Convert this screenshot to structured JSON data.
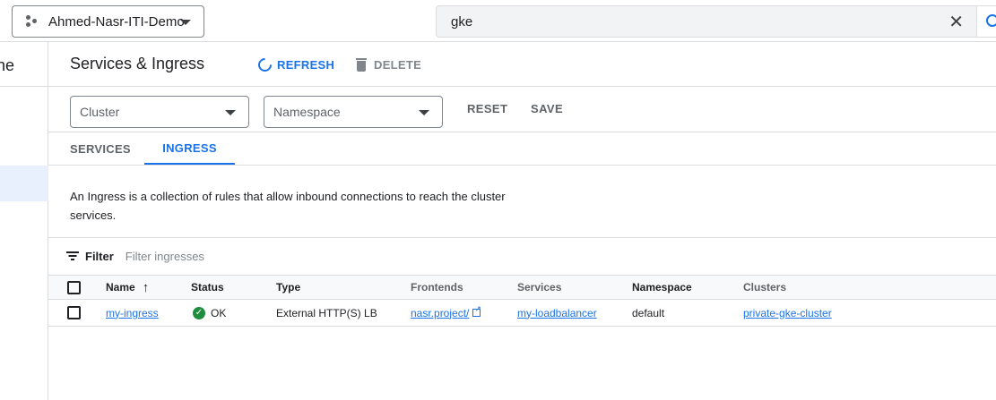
{
  "topbar": {
    "project_name": "Ahmed-Nasr-ITI-Demo",
    "search_value": "gke",
    "clear_glyph": "✕",
    "icons": [
      "project-dots-icon",
      "chevron-down-icon",
      "close-icon",
      "search-icon"
    ]
  },
  "leftnav": {
    "title_fragment": "ne"
  },
  "header": {
    "title": "Services & Ingress",
    "refresh_label": "REFRESH",
    "delete_label": "DELETE"
  },
  "filters": {
    "cluster_label": "Cluster",
    "namespace_label": "Namespace",
    "reset_label": "RESET",
    "save_label": "SAVE"
  },
  "tabs": [
    {
      "label": "SERVICES"
    },
    {
      "label": "INGRESS",
      "active": true
    }
  ],
  "description": "An Ingress is a collection of rules that allow inbound connections to reach the cluster services.",
  "table_filter": {
    "label": "Filter",
    "placeholder": "Filter ingresses"
  },
  "table": {
    "columns": [
      "Name",
      "Status",
      "Type",
      "Frontends",
      "Services",
      "Namespace",
      "Clusters"
    ],
    "sort_glyph": "↑",
    "rows": [
      {
        "name": "my-ingress",
        "status": "OK",
        "status_glyph": "✓",
        "type": "External HTTP(S) LB",
        "frontends": "nasr.project/",
        "services": "my-loadbalancer",
        "namespace": "default",
        "clusters": "private-gke-cluster"
      }
    ]
  },
  "colors": {
    "accent": "#1a73e8",
    "ok": "#1e8e3e",
    "border": "#dadce0",
    "active_nav_bg": "#e8f0fe"
  }
}
